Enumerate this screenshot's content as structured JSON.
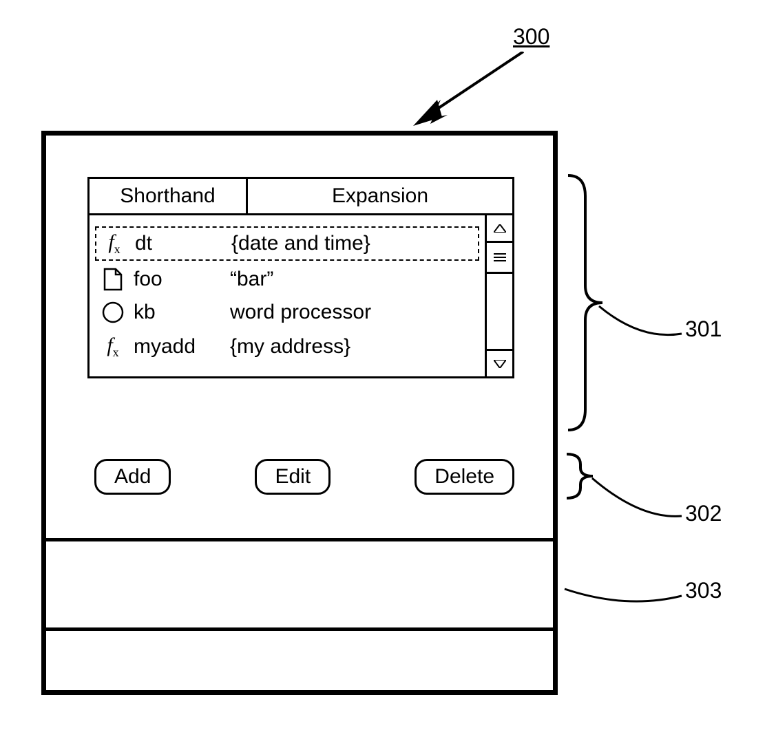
{
  "refs": {
    "main": "300",
    "list": "301",
    "buttons": "302",
    "bottom": "303"
  },
  "headers": {
    "shorthand": "Shorthand",
    "expansion": "Expansion"
  },
  "rows": [
    {
      "icon": "fx",
      "shorthand": "dt",
      "expansion": "{date and time}",
      "selected": true
    },
    {
      "icon": "page",
      "shorthand": "foo",
      "expansion": "“bar”",
      "selected": false
    },
    {
      "icon": "circle",
      "shorthand": "kb",
      "expansion": "word processor",
      "selected": false
    },
    {
      "icon": "fx",
      "shorthand": "myadd",
      "expansion": "{my address}",
      "selected": false
    }
  ],
  "buttons": {
    "add": "Add",
    "edit": "Edit",
    "delete": "Delete"
  }
}
